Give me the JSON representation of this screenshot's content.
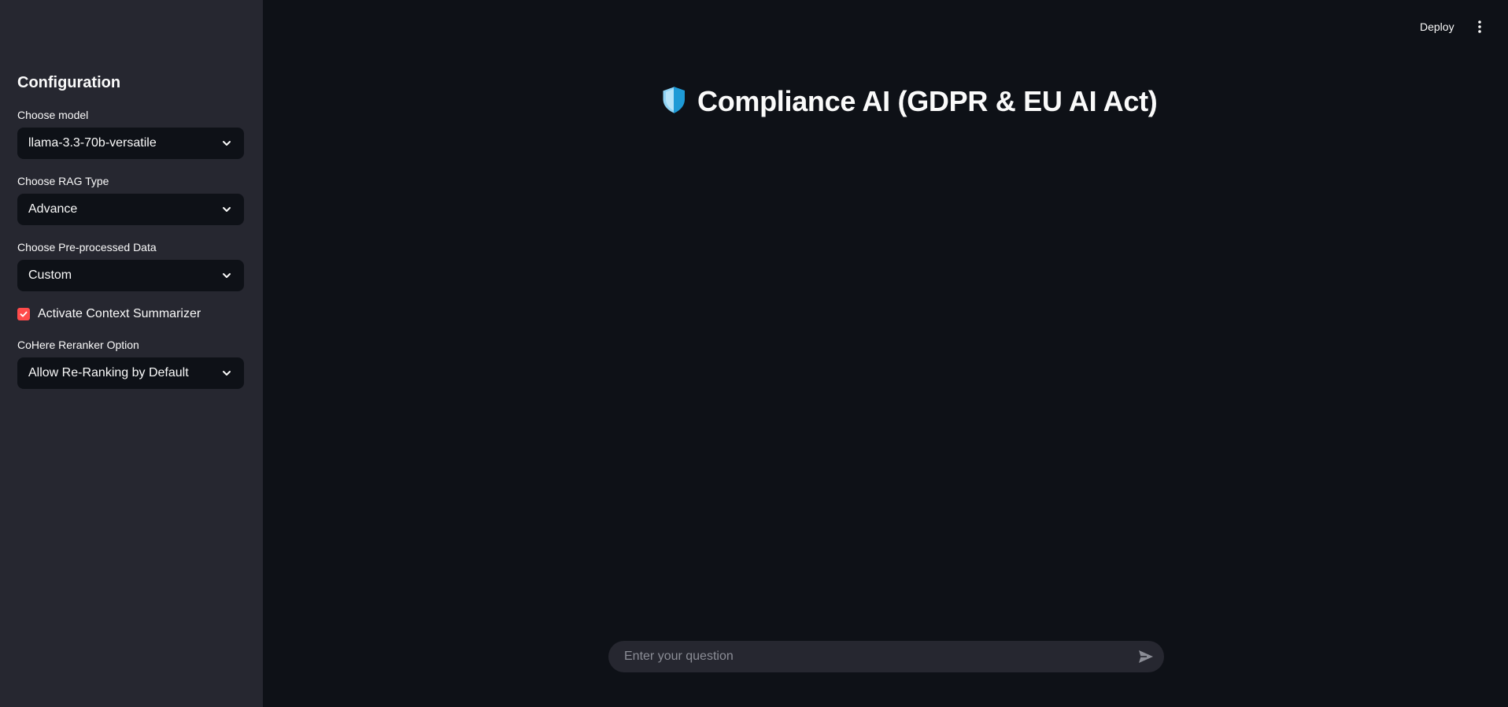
{
  "header": {
    "deploy_label": "Deploy",
    "menu_icon": "kebab-menu-icon"
  },
  "sidebar": {
    "title": "Configuration",
    "model": {
      "label": "Choose model",
      "value": "llama-3.3-70b-versatile"
    },
    "rag_type": {
      "label": "Choose RAG Type",
      "value": "Advance"
    },
    "preprocessed": {
      "label": "Choose Pre-processed Data",
      "value": "Custom"
    },
    "context_summarizer": {
      "label": "Activate Context Summarizer",
      "checked": true
    },
    "reranker": {
      "label": "CoHere Reranker Option",
      "value": "Allow Re-Ranking by Default"
    }
  },
  "main": {
    "title": "Compliance AI (GDPR & EU AI Act)",
    "title_icon": "shield-icon"
  },
  "chat": {
    "placeholder": "Enter your question",
    "value": "",
    "send_icon": "send-icon"
  },
  "colors": {
    "background": "#0e1117",
    "sidebar": "#262730",
    "accent": "#ff4b4b",
    "shield_light": "#8fd3f4",
    "shield_dark": "#1e9ad6"
  }
}
